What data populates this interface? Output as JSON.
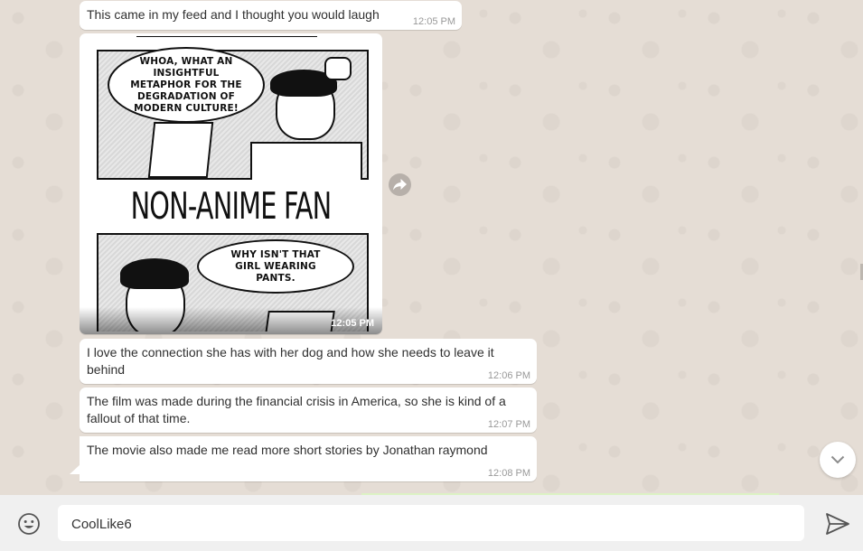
{
  "messages": [
    {
      "text": "This came in my feed and I thought you would laugh",
      "time": "12:05 PM"
    },
    {
      "type": "image",
      "time": "12:05 PM",
      "comic": {
        "top_speech": "WHOA, WHAT AN INSIGHTFUL METAPHOR FOR THE DEGRADATION OF MODERN CULTURE!",
        "caption": "NON-ANIME FAN",
        "bottom_speech": "WHY ISN'T THAT GIRL WEARING PANTS."
      }
    },
    {
      "text": "I love the connection she has with her dog and how she needs to leave it behind",
      "time": "12:06 PM"
    },
    {
      "text": "The film was made during the financial crisis in America, so she is kind of a fallout of that time.",
      "time": "12:07 PM"
    },
    {
      "text": "The movie also made me read more short stories by Jonathan raymond",
      "time": "12:08 PM"
    }
  ],
  "composer": {
    "value": "CoolLike6"
  },
  "icons": {
    "forward": "forward-icon",
    "scroll_down": "chevron-down-icon",
    "emoji": "emoji-icon",
    "send": "send-icon"
  },
  "colors": {
    "chat_bg": "#e5ddd5",
    "bubble_incoming": "#ffffff",
    "footer_bg": "#f0f0f0"
  }
}
